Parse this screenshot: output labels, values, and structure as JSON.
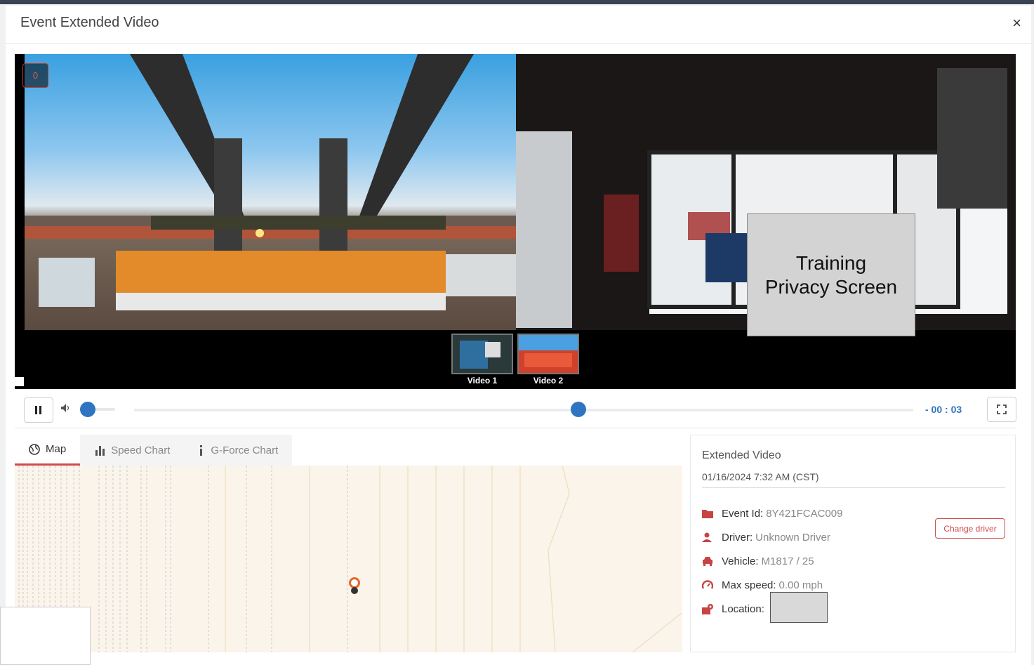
{
  "modal": {
    "title": "Event Extended Video",
    "close_label": "×"
  },
  "player": {
    "event_counter": "0",
    "privacy_text_line1": "Training",
    "privacy_text_line2": "Privacy Screen",
    "thumbnails": [
      {
        "label": "Video 1"
      },
      {
        "label": "Video 2"
      }
    ],
    "playback_progress": 0.57,
    "volume_level": 0.0,
    "remaining_time": "- 00 : 03"
  },
  "tabs": [
    {
      "label": "Map",
      "icon": "globe-icon",
      "active": true
    },
    {
      "label": "Speed Chart",
      "icon": "bar-chart-icon",
      "active": false
    },
    {
      "label": "G-Force Chart",
      "icon": "info-icon",
      "active": false
    }
  ],
  "info": {
    "title": "Extended Video",
    "date": "01/16/2024 7:32 AM (CST)",
    "event_id_label": "Event Id:",
    "event_id": "8Y421FCAC009",
    "driver_label": "Driver:",
    "driver": "Unknown Driver",
    "change_driver_label": "Change driver",
    "vehicle_label": "Vehicle:",
    "vehicle": "M1817 / 25",
    "max_speed_label": "Max speed:",
    "max_speed": "0.00 mph",
    "location_label": "Location:"
  },
  "colors": {
    "accent_red": "#d04b4b",
    "accent_blue": "#2f74c0"
  }
}
